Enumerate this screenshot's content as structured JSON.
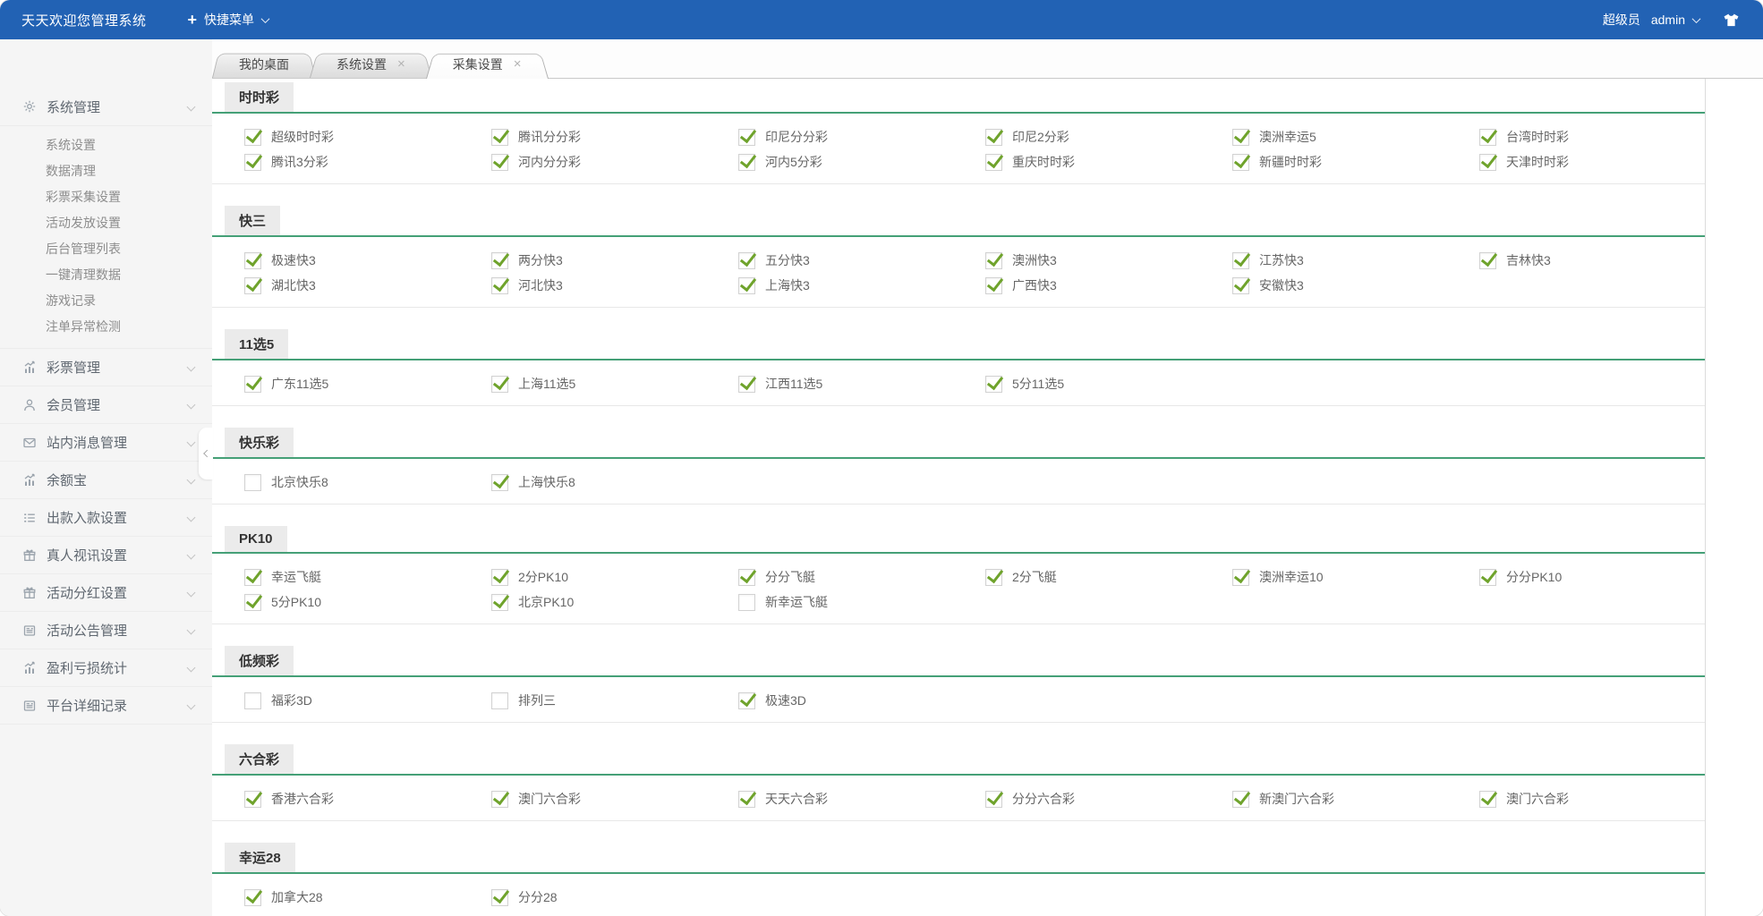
{
  "topbar": {
    "title": "天天欢迎您管理系统",
    "quick_menu_label": "快捷菜单",
    "role": "超级员",
    "username": "admin"
  },
  "icons": {
    "plus-icon": "+",
    "close-icon": "×",
    "chevron-down-icon": "v",
    "tshirt-icon": "tshirt"
  },
  "sidebar": {
    "groups": [
      {
        "label": "系统管理",
        "icon": "gear-icon",
        "expanded": true,
        "children": [
          "系统设置",
          "数据清理",
          "彩票采集设置",
          "活动发放设置",
          "后台管理列表",
          "一键清理数据",
          "游戏记录",
          "注单异常检测"
        ]
      },
      {
        "label": "彩票管理",
        "icon": "chart-icon"
      },
      {
        "label": "会员管理",
        "icon": "user-icon"
      },
      {
        "label": "站内消息管理",
        "icon": "mail-icon"
      },
      {
        "label": "余额宝",
        "icon": "chart-icon"
      },
      {
        "label": "出款入款设置",
        "icon": "list-icon"
      },
      {
        "label": "真人视讯设置",
        "icon": "gift-icon"
      },
      {
        "label": "活动分红设置",
        "icon": "gift-icon"
      },
      {
        "label": "活动公告管理",
        "icon": "news-icon"
      },
      {
        "label": "盈利亏损统计",
        "icon": "chart-icon"
      },
      {
        "label": "平台详细记录",
        "icon": "news-icon"
      }
    ]
  },
  "tabs": [
    {
      "label": "我的桌面",
      "closable": false,
      "active": false
    },
    {
      "label": "系统设置",
      "closable": true,
      "active": false
    },
    {
      "label": "采集设置",
      "closable": true,
      "active": true
    }
  ],
  "sections": [
    {
      "title": "时时彩",
      "items": [
        {
          "label": "超级时时彩",
          "checked": true
        },
        {
          "label": "腾讯分分彩",
          "checked": true
        },
        {
          "label": "印尼分分彩",
          "checked": true
        },
        {
          "label": "印尼2分彩",
          "checked": true
        },
        {
          "label": "澳洲幸运5",
          "checked": true
        },
        {
          "label": "台湾时时彩",
          "checked": true
        },
        {
          "label": "腾讯3分彩",
          "checked": true
        },
        {
          "label": "河内分分彩",
          "checked": true
        },
        {
          "label": "河内5分彩",
          "checked": true
        },
        {
          "label": "重庆时时彩",
          "checked": true
        },
        {
          "label": "新疆时时彩",
          "checked": true
        },
        {
          "label": "天津时时彩",
          "checked": true
        }
      ]
    },
    {
      "title": "快三",
      "items": [
        {
          "label": "极速快3",
          "checked": true
        },
        {
          "label": "两分快3",
          "checked": true
        },
        {
          "label": "五分快3",
          "checked": true
        },
        {
          "label": "澳洲快3",
          "checked": true
        },
        {
          "label": "江苏快3",
          "checked": true
        },
        {
          "label": "吉林快3",
          "checked": true
        },
        {
          "label": "湖北快3",
          "checked": true
        },
        {
          "label": "河北快3",
          "checked": true
        },
        {
          "label": "上海快3",
          "checked": true
        },
        {
          "label": "广西快3",
          "checked": true
        },
        {
          "label": "安徽快3",
          "checked": true
        }
      ]
    },
    {
      "title": "11选5",
      "items": [
        {
          "label": "广东11选5",
          "checked": true
        },
        {
          "label": "上海11选5",
          "checked": true
        },
        {
          "label": "江西11选5",
          "checked": true
        },
        {
          "label": "5分11选5",
          "checked": true
        }
      ]
    },
    {
      "title": "快乐彩",
      "items": [
        {
          "label": "北京快乐8",
          "checked": false
        },
        {
          "label": "上海快乐8",
          "checked": true
        }
      ]
    },
    {
      "title": "PK10",
      "items": [
        {
          "label": "幸运飞艇",
          "checked": true
        },
        {
          "label": "2分PK10",
          "checked": true
        },
        {
          "label": "分分飞艇",
          "checked": true
        },
        {
          "label": "2分飞艇",
          "checked": true
        },
        {
          "label": "澳洲幸运10",
          "checked": true
        },
        {
          "label": "分分PK10",
          "checked": true
        },
        {
          "label": "5分PK10",
          "checked": true
        },
        {
          "label": "北京PK10",
          "checked": true
        },
        {
          "label": "新幸运飞艇",
          "checked": false
        }
      ]
    },
    {
      "title": "低频彩",
      "items": [
        {
          "label": "福彩3D",
          "checked": false
        },
        {
          "label": "排列三",
          "checked": false
        },
        {
          "label": "极速3D",
          "checked": true
        }
      ]
    },
    {
      "title": "六合彩",
      "items": [
        {
          "label": "香港六合彩",
          "checked": true
        },
        {
          "label": "澳门六合彩",
          "checked": true
        },
        {
          "label": "天天六合彩",
          "checked": true
        },
        {
          "label": "分分六合彩",
          "checked": true
        },
        {
          "label": "新澳门六合彩",
          "checked": true
        },
        {
          "label": "澳门六合彩",
          "checked": true
        }
      ]
    },
    {
      "title": "幸运28",
      "items": [
        {
          "label": "加拿大28",
          "checked": true
        },
        {
          "label": "分分28",
          "checked": true
        }
      ]
    }
  ],
  "colors": {
    "topbar_blue": "#2262b4",
    "section_line_green": "#45a077",
    "check_green": "#6fa32c"
  }
}
